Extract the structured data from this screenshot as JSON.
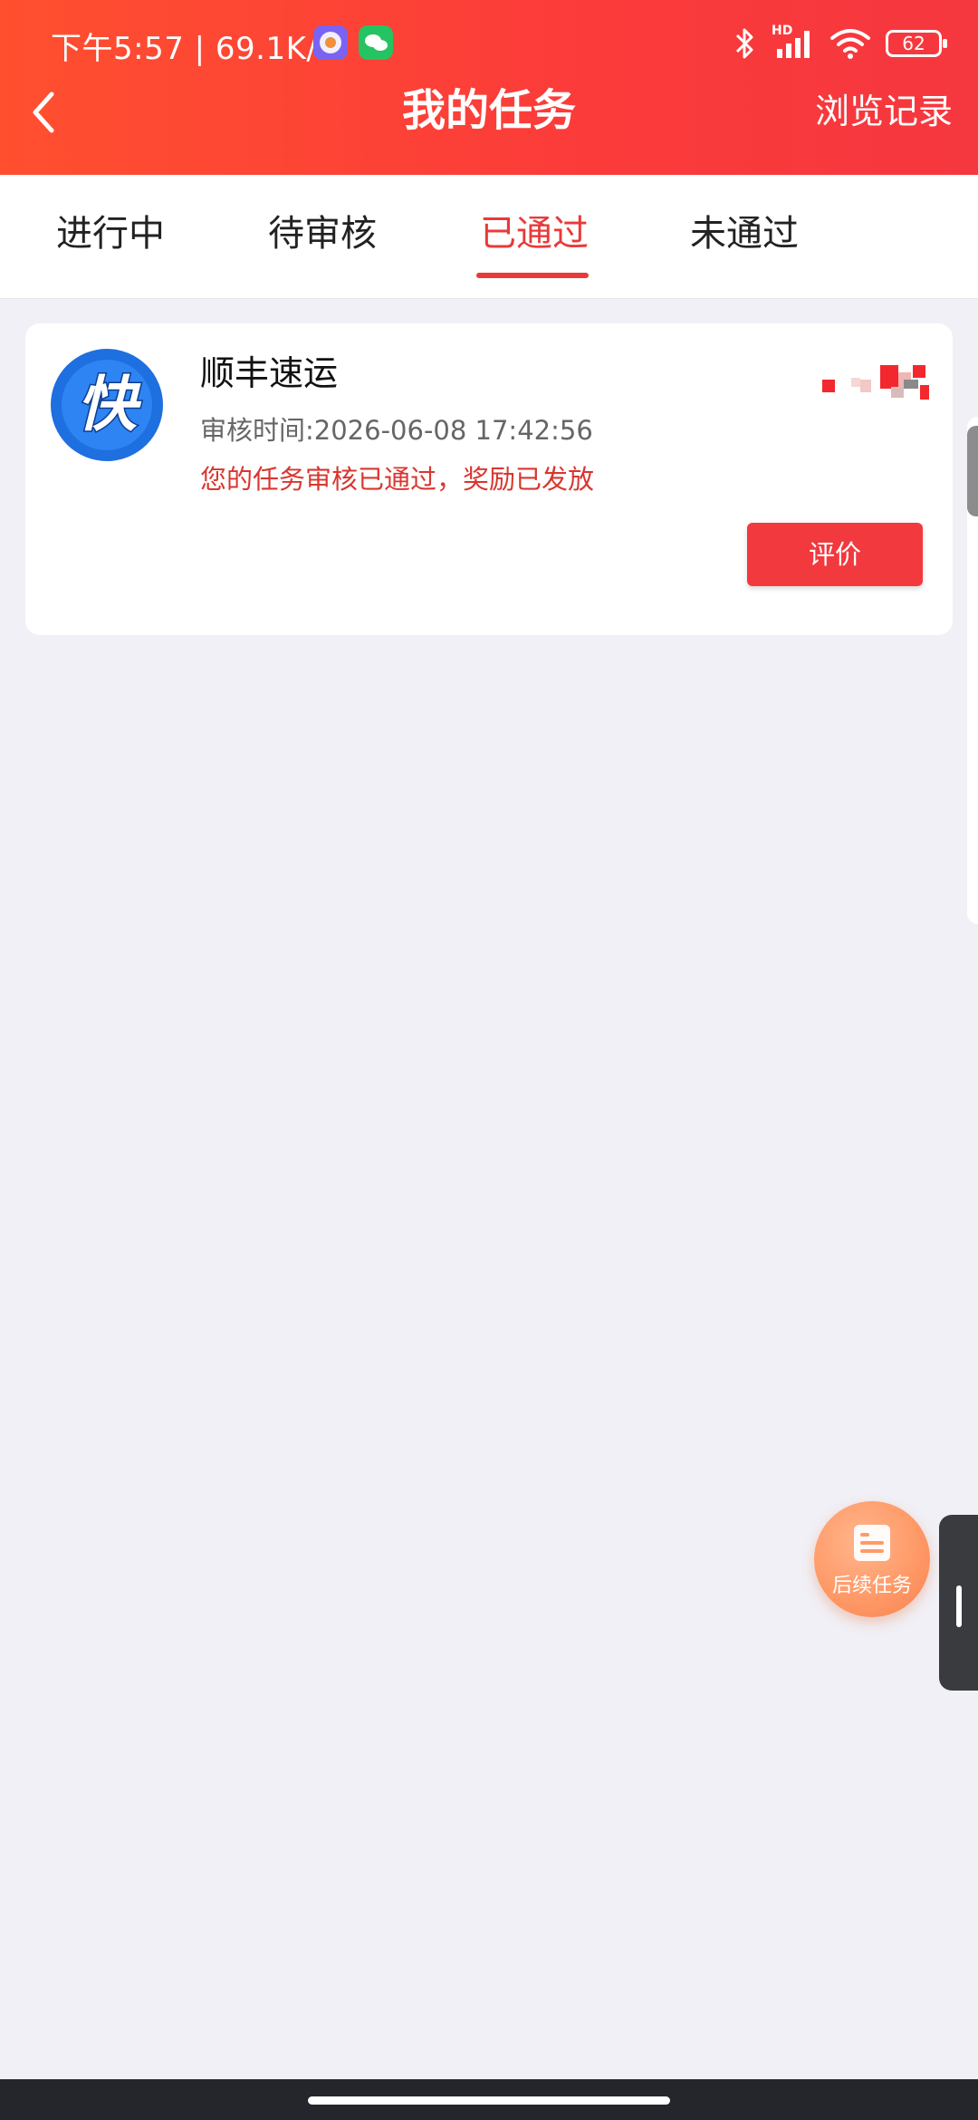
{
  "status_bar": {
    "time_speed": "下午5:57 | 69.1K/s",
    "signal": "HD",
    "battery": "62"
  },
  "header": {
    "title": "我的任务",
    "right_action": "浏览记录"
  },
  "tabs": [
    {
      "label": "进行中"
    },
    {
      "label": "待审核"
    },
    {
      "label": "已通过",
      "active": true
    },
    {
      "label": "未通过"
    }
  ],
  "task": {
    "logo_char": "快",
    "name": "顺丰速运",
    "review_time": "审核时间:2026-06-08 17:42:56",
    "status_message": "您的任务审核已通过，奖励已发放",
    "action_label": "评价"
  },
  "float_button": {
    "label": "后续任务"
  },
  "colors": {
    "accent": "#e83a3a",
    "header": "#fb3b3a",
    "background": "#f1f0f6",
    "float": "#ff9a68"
  }
}
